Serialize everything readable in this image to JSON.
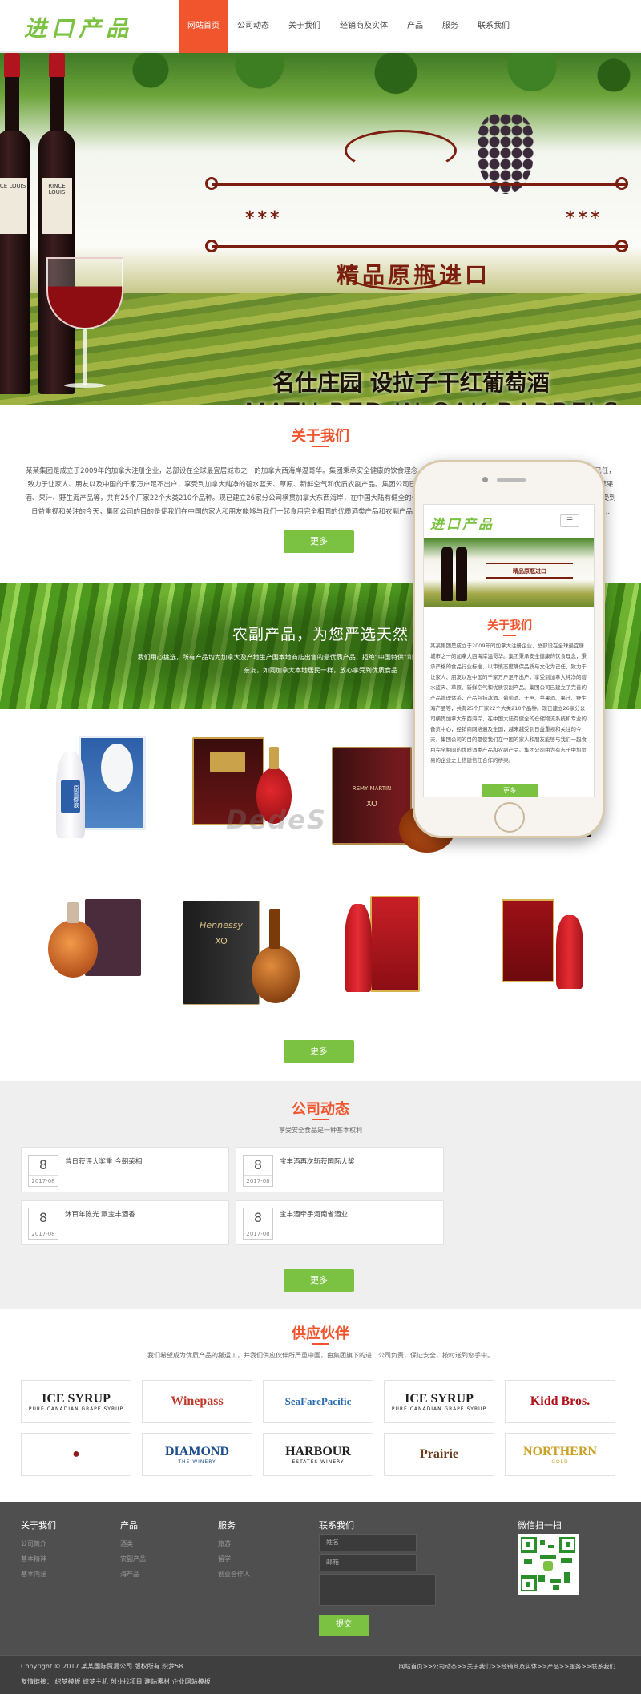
{
  "header": {
    "logo": "进口产品",
    "nav": [
      {
        "label": "网站首页",
        "active": true
      },
      {
        "label": "公司动态"
      },
      {
        "label": "关于我们"
      },
      {
        "label": "经销商及实体"
      },
      {
        "label": "产品"
      },
      {
        "label": "服务"
      },
      {
        "label": "联系我们"
      }
    ]
  },
  "banner": {
    "stars": "***",
    "title": "精品原瓶进口",
    "subtitle": "名仕庄园 设拉子干红葡萄酒",
    "subtitle_en": "MATU RED IN OAK BARRELS",
    "bottle_label_1": "ICE LOUIS",
    "bottle_label_2": "RINCE LOUIS"
  },
  "about": {
    "title": "关于我们",
    "text": "某某集团是成立于2009年的加拿大注册企业，总部设在全球最宜居城市之一的加拿大西海岸温哥华。集团秉承安全健康的饮食理念，秉承严格的食品行业标准，以审慎态度确保品质与文化为己任，致力于让家人、朋友以及中国的千家万户足不出户，享受到加拿大纯净的碧水蓝天、草原、新鲜空气和优质农副产品。集团公司已建立了完善的产品管理体系，产品包括冰酒、葡萄酒、干邑、苹果酒、果汁、野生海产品等，共有25个厂家22个大类210个品种。现已建立26家分公司横贯加拿大东西海岸，在中国大陆有健全的仓储物流系统和专业的备货中心，经销商网络遍及全国，越来越受到日益重视和关注的今天，集团公司的目的是使我们在中国的家人和朋友能够与我们一起食用完全相同的优质酒类产品和农副产品。集团公司由为有志于中加贸易的企业之士搭建信任合作的桥梁...",
    "more": "更多"
  },
  "products_band": {
    "title": "农副产品，为您严选天然",
    "text": "我们用心挑选，所有产品均为加拿大及产地生产国本地商店出售的最优质产品，拒绝“中国特供”和“外国商标中国产”，让您和您的亲友，如同加拿大本地居民一样，放心享受到优质食品"
  },
  "products": {
    "watermark": "DedeS",
    "more": "更多",
    "row1": [
      {
        "name": "product-baijiu-gift-box",
        "brand": "原窖御液"
      },
      {
        "name": "product-red-wine-gift-box"
      },
      {
        "name": "product-remy-martin-xo",
        "brand": "REMY MARTIN",
        "sub": "XO"
      },
      {
        "name": "product-brandy-box"
      }
    ],
    "row2": [
      {
        "name": "product-cognac-decanter"
      },
      {
        "name": "product-hennessy-xo",
        "brand": "Hennessy",
        "sub": "XO"
      },
      {
        "name": "product-red-baijiu-set"
      },
      {
        "name": "product-red-baijiu-gift"
      }
    ]
  },
  "news": {
    "title": "公司动态",
    "subtitle": "享受安全食品是一种基本权利",
    "items": [
      {
        "day": "8",
        "ym": "2017-08",
        "title": "昔日获评大奖重 今朝荣相"
      },
      {
        "day": "8",
        "ym": "2017-08",
        "title": "宝丰酒再次斩获国际大奖"
      },
      {
        "day": "8",
        "ym": "2017-08",
        "title": "沐百年陈光 飘宝丰酒香"
      },
      {
        "day": "8",
        "ym": "2017-08",
        "title": "宝丰酒牵手河南省酒业"
      }
    ],
    "more": "更多"
  },
  "partners": {
    "title": "供应伙伴",
    "subtitle": "我们希望成为优质产品的搬运工，并我们供应伙伴所严重中国，由集团旗下的进口公司负责，保证安全，按时送到您手中。",
    "logos": [
      {
        "line1": "ICE SYRUP",
        "line2": "PURE CANADIAN GRAPE SYRUP",
        "color": "#222"
      },
      {
        "line1": "Winepass",
        "line2": "",
        "color": "#c0392b"
      },
      {
        "line1": "SeaFarePacific",
        "line2": "",
        "color": "#2a6db0"
      },
      {
        "line1": "ICE SYRUP",
        "line2": "PURE CANADIAN GRAPE SYRUP",
        "color": "#222"
      },
      {
        "line1": "Kidd Bros.",
        "line2": "",
        "color": "#b0121b"
      },
      {
        "line1": "●",
        "line2": "",
        "color": "#8a1c1c"
      },
      {
        "line1": "DIAMOND",
        "line2": "THE WINERY",
        "color": "#1f4e8c"
      },
      {
        "line1": "HARBOUR",
        "line2": "ESTATES WINERY",
        "color": "#222"
      },
      {
        "line1": "Prairie",
        "line2": "",
        "color": "#6b3b1a"
      },
      {
        "line1": "NORTHERN",
        "line2": "GOLD",
        "color": "#c9a227"
      }
    ]
  },
  "phone": {
    "logo": "进口产品",
    "menu": "☰",
    "banner_text": "精品原瓶进口",
    "title": "关于我们",
    "text": "某某集团是成立于2009年的加拿大注册企业，总部设在全球最宜居城市之一的加拿大西海岸温哥华。集团秉承安全健康的饮食理念，秉承严格的食品行业标准，以审慎态度确保品质与文化为己任，致力于让家人、朋友以及中国的千家万户足不出户，享受到加拿大纯净的碧水蓝天、草原、新鲜空气和优质农副产品。集团公司已建立了完善的产品管理体系，产品包括冰酒、葡萄酒、干邑、苹果酒、果汁、野生海产品等，共有25个厂家22个大类210个品种。现已建立26家分公司横贯加拿大东西海岸，在中国大陆有健全的仓储物流系统和专业的备货中心，经销商网络遍及全国，越来越受到日益重视和关注的今天，集团公司的目的是使我们在中国的家人和朋友能够与我们一起食用完全相同的优质酒类产品和农副产品。集团公司由为有志于中加贸易的企业之士搭建信任合作的桥梁。",
    "more": "更多"
  },
  "footer": {
    "cols": [
      {
        "title": "关于我们",
        "items": [
          "公司简介",
          "基本精神",
          "基本内涵"
        ]
      },
      {
        "title": "产品",
        "items": [
          "酒类",
          "农副产品",
          "海产品"
        ]
      },
      {
        "title": "服务",
        "items": [
          "旅游",
          "留学",
          "创业合作人"
        ]
      }
    ],
    "contact_title": "联系我们",
    "name_placeholder": "姓名",
    "email_placeholder": "邮箱",
    "submit": "提交",
    "wechat_title": "微信扫一扫",
    "copyright": "Copyright © 2017 某某国际贸易公司 版权所有  织梦58",
    "links": "友情链接： 织梦模板  织梦主机  创业找项目  建站素材  企业网站模板",
    "breadcrumb": "网站首页>>公司动态>>关于我们>>经销商及实体>>产品>>服务>>联系我们"
  }
}
